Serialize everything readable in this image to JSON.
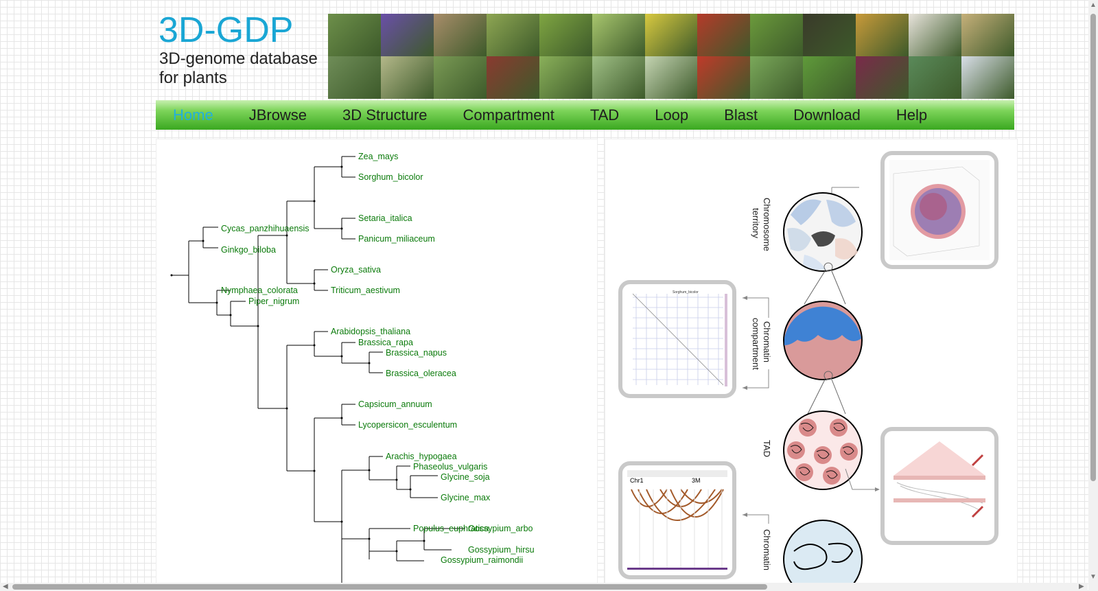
{
  "site": {
    "title": "3D-GDP",
    "subtitle": "3D-genome database for plants"
  },
  "banner": {
    "tiles": [
      "#6d8f4a",
      "#6a4fa8",
      "#a88d6a",
      "#8ea653",
      "#7fa542",
      "#a8c66e",
      "#d8c940",
      "#b53a2a",
      "#6b9a3c",
      "#3a3a2a",
      "#c89a3a",
      "#e8e4dc",
      "#c6b07a",
      "#6f8d58",
      "#b4b88a",
      "#7a9a55",
      "#8a3a30",
      "#8ab05a",
      "#9fbf85",
      "#c4d4b2",
      "#c03a2a",
      "#7aa85a",
      "#5f9a3a",
      "#7a2a4a",
      "#5a8a5a",
      "#d9dfe8"
    ]
  },
  "nav": {
    "items": [
      {
        "label": "Home",
        "active": true
      },
      {
        "label": "JBrowse",
        "active": false
      },
      {
        "label": "3D Structure",
        "active": false
      },
      {
        "label": "Compartment",
        "active": false
      },
      {
        "label": "TAD",
        "active": false
      },
      {
        "label": "Loop",
        "active": false
      },
      {
        "label": "Blast",
        "active": false
      },
      {
        "label": "Download",
        "active": false
      },
      {
        "label": "Help",
        "active": false
      }
    ]
  },
  "tree": {
    "species": [
      "Zea_mays",
      "Sorghum_bicolor",
      "Setaria_italica",
      "Panicum_miliaceum",
      "Cycas_panzhihuaensis",
      "Ginkgo_biloba",
      "Oryza_sativa",
      "Triticum_aestivum",
      "Nymphaea_colorata",
      "Piper_nigrum",
      "Arabidopsis_thaliana",
      "Brassica_rapa",
      "Brassica_napus",
      "Brassica_oleracea",
      "Capsicum_annuum",
      "Lycopersicon_esculentum",
      "Arachis_hypogaea",
      "Phaseolus_vulgaris",
      "Glycine_soja",
      "Glycine_max",
      "Populus_euphratica",
      "Gossypium_arbo",
      "Gossypium_hirsu",
      "Gossypium_raimondii"
    ]
  },
  "diagram": {
    "labels": {
      "territory": [
        "Chromosome",
        "territory"
      ],
      "compartment": [
        "Chromatin",
        "compartment"
      ],
      "tad": "TAD",
      "loop": "Chromatin"
    },
    "thumb_compartment_title": "Sorghum_bicolor",
    "thumb_loop_left": "Chr1",
    "thumb_loop_right": "3M"
  },
  "colors": {
    "title": "#1aa6d4",
    "nav_active": "#22b0dc",
    "tree_label": "#0a7a0a"
  }
}
